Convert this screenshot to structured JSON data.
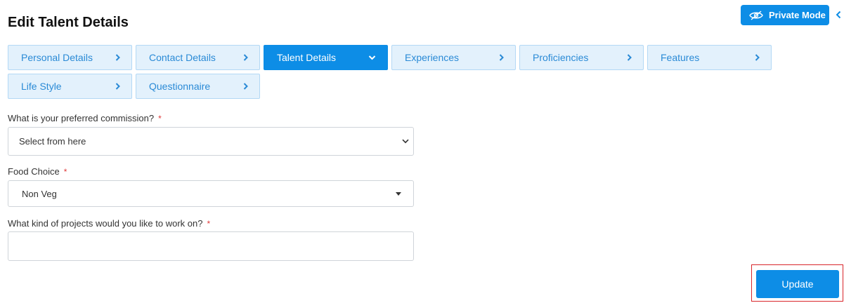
{
  "page": {
    "title": "Edit Talent Details"
  },
  "header": {
    "private_mode_label": "Private Mode"
  },
  "tabs": [
    {
      "label": "Personal Details",
      "active": false
    },
    {
      "label": "Contact Details",
      "active": false
    },
    {
      "label": "Talent Details",
      "active": true
    },
    {
      "label": "Experiences",
      "active": false
    },
    {
      "label": "Proficiencies",
      "active": false
    },
    {
      "label": "Features",
      "active": false
    },
    {
      "label": "Life Style",
      "active": false
    },
    {
      "label": "Questionnaire",
      "active": false
    }
  ],
  "form": {
    "commission": {
      "label": "What is your preferred commission?",
      "required_mark": "*",
      "value": "Select from here"
    },
    "food": {
      "label": "Food Choice",
      "required_mark": "*",
      "value": "Non Veg"
    },
    "projects": {
      "label": "What kind of projects would you like to work on?",
      "required_mark": "*",
      "value": ""
    }
  },
  "actions": {
    "update_label": "Update"
  },
  "colors": {
    "accent": "#0d8de6",
    "tab_bg": "#e3f1fc",
    "tab_text": "#2a8ad6",
    "required": "#e03a3a",
    "highlight_outline": "#d9262b"
  },
  "icons": {
    "private_mode": "eye-slash-icon",
    "collapse": "chevron-left-icon",
    "tab_inactive": "chevron-right-icon",
    "tab_active": "chevron-down-icon"
  }
}
